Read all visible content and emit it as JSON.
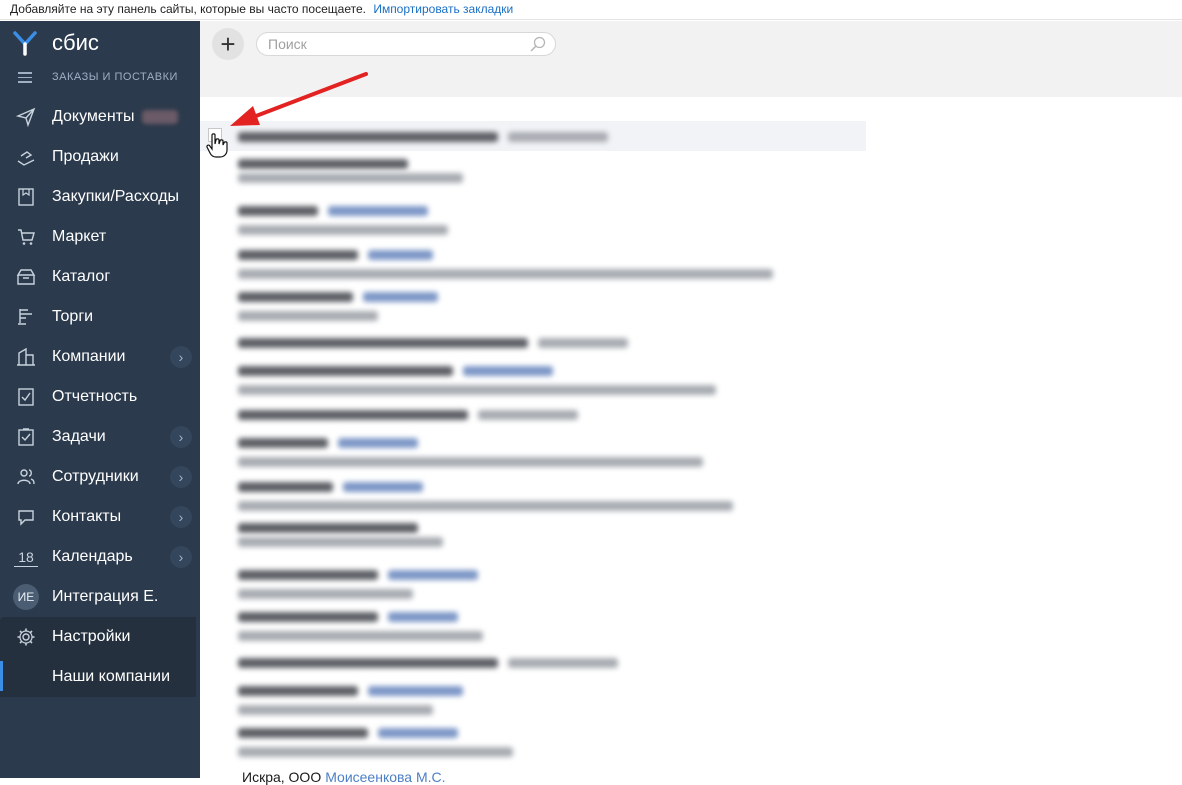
{
  "bookmarks_bar": {
    "text": "Добавляйте на эту панель сайты, которые вы часто посещаете.",
    "link": "Импортировать закладки"
  },
  "sidebar": {
    "logo_text": "сбис",
    "section_label": "ЗАКАЗЫ И ПОСТАВКИ",
    "items": [
      {
        "label": "Документы",
        "icon": "paper-plane-icon",
        "badge": true
      },
      {
        "label": "Продажи",
        "icon": "hand-coins-icon"
      },
      {
        "label": "Закупки/Расходы",
        "icon": "receipt-icon"
      },
      {
        "label": "Маркет",
        "icon": "cart-icon"
      },
      {
        "label": "Каталог",
        "icon": "box-icon"
      },
      {
        "label": "Торги",
        "icon": "gavel-icon"
      },
      {
        "label": "Компании",
        "icon": "building-icon",
        "chevron": true
      },
      {
        "label": "Отчетность",
        "icon": "report-icon"
      },
      {
        "label": "Задачи",
        "icon": "task-icon",
        "chevron": true
      },
      {
        "label": "Сотрудники",
        "icon": "people-icon",
        "chevron": true
      },
      {
        "label": "Контакты",
        "icon": "chat-icon",
        "chevron": true
      },
      {
        "label": "Календарь",
        "icon": "calendar-icon",
        "calendar_day": "18",
        "chevron": true
      },
      {
        "label": "Интеграция Е.",
        "avatar": "ИЕ"
      },
      {
        "label": "Настройки",
        "icon": "gear-icon"
      },
      {
        "label": "Наши компании"
      }
    ]
  },
  "toolbar": {
    "add_label": "+",
    "search_placeholder": "Поиск"
  },
  "list": {
    "last_row": {
      "company": "Искра, ООО",
      "person": "Моисеенкова М.С."
    }
  }
}
